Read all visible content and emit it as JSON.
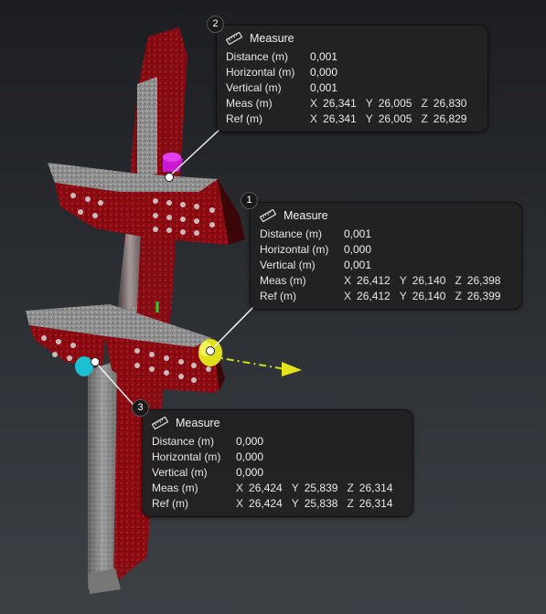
{
  "colors": {
    "background_top": "#1c1e22",
    "background_bottom": "#3d4146",
    "steel_red": "#8f0a12",
    "steel_grey": "#9a9a9a",
    "panel_bg": "#222224",
    "marker_magenta": "#d020d8",
    "marker_yellow": "#e4e41a",
    "marker_cyan": "#1fc4d4",
    "axis_green": "#2ad02a",
    "axis_yellow": "#d8d820"
  },
  "scene": {
    "point_cloud": "steel-column-scan"
  },
  "measurements": [
    {
      "index": "2",
      "icon": "ruler-icon",
      "title": "Measure",
      "labels": {
        "distance": "Distance (m)",
        "horizontal": "Horizontal (m)",
        "vertical": "Vertical (m)",
        "meas": "Meas (m)",
        "ref": "Ref (m)"
      },
      "distance": "0,001",
      "horizontal": "0,000",
      "vertical": "0,001",
      "meas": {
        "x": "26,341",
        "y": "26,005",
        "z": "26,830"
      },
      "ref": {
        "x": "26,341",
        "y": "26,005",
        "z": "26,829"
      }
    },
    {
      "index": "1",
      "icon": "ruler-icon",
      "title": "Measure",
      "labels": {
        "distance": "Distance (m)",
        "horizontal": "Horizontal (m)",
        "vertical": "Vertical (m)",
        "meas": "Meas (m)",
        "ref": "Ref (m)"
      },
      "distance": "0,001",
      "horizontal": "0,000",
      "vertical": "0,001",
      "meas": {
        "x": "26,412",
        "y": "26,140",
        "z": "26,398"
      },
      "ref": {
        "x": "26,412",
        "y": "26,140",
        "z": "26,399"
      }
    },
    {
      "index": "3",
      "icon": "ruler-icon",
      "title": "Measure",
      "labels": {
        "distance": "Distance (m)",
        "horizontal": "Horizontal (m)",
        "vertical": "Vertical (m)",
        "meas": "Meas (m)",
        "ref": "Ref (m)"
      },
      "distance": "0,000",
      "horizontal": "0,000",
      "vertical": "0,000",
      "meas": {
        "x": "26,424",
        "y": "25,839",
        "z": "26,314"
      },
      "ref": {
        "x": "26,424",
        "y": "25,838",
        "z": "26,314"
      }
    }
  ],
  "axis_labels": {
    "x": "X",
    "y": "Y",
    "z": "Z"
  }
}
